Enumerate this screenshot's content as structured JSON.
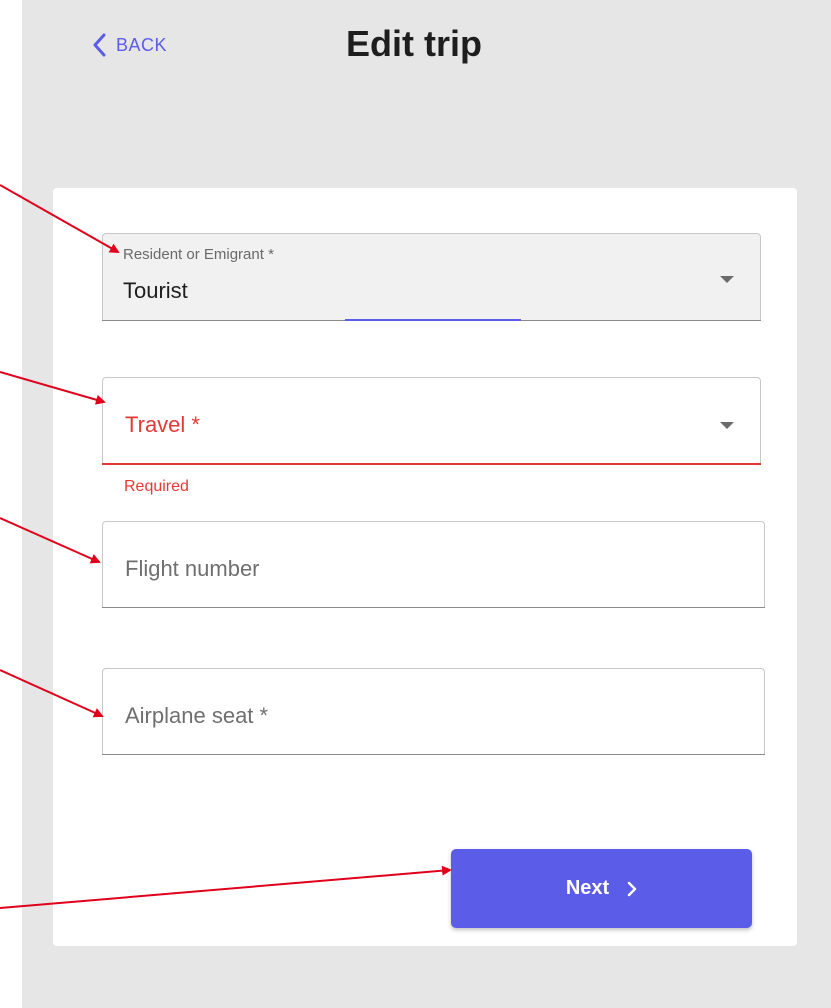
{
  "header": {
    "back_label": "BACK",
    "title": "Edit trip"
  },
  "form": {
    "resident": {
      "label": "Resident or Emigrant *",
      "value": "Tourist"
    },
    "travel": {
      "label": "Travel *",
      "error": "Required"
    },
    "flight_number": {
      "placeholder": "Flight number"
    },
    "airplane_seat": {
      "placeholder": "Airplane seat *"
    }
  },
  "actions": {
    "next_label": "Next"
  },
  "colors": {
    "accent": "#5b5de8",
    "error": "#e53935",
    "annotation_arrow": "#e0001b",
    "app_background": "#e6e6e6"
  },
  "icons": {
    "back": "chevron-left-icon",
    "dropdown": "caret-down-icon",
    "next": "chevron-right-icon"
  }
}
